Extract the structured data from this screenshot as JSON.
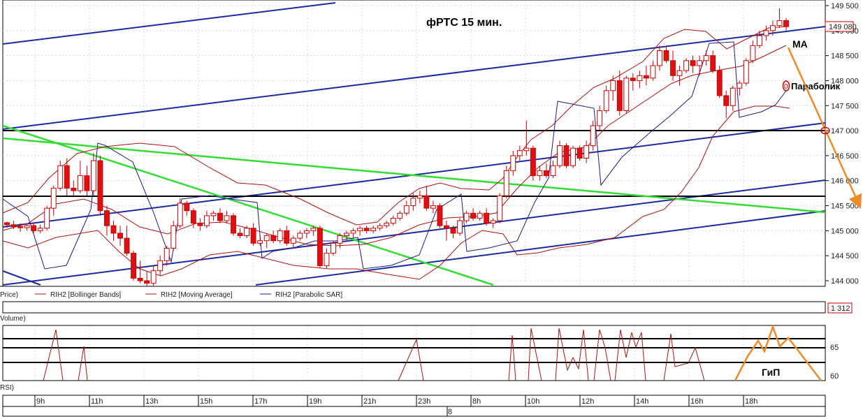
{
  "chart_data": {
    "type": "candlestick",
    "title": "фРТС   15 мин.",
    "ylim": [
      143900,
      149560
    ],
    "y_ticks": [
      "149 500",
      "149 000",
      "148 500",
      "148 000",
      "147 500",
      "147 000",
      "146 500",
      "146 000",
      "145 500",
      "145 000",
      "144 500",
      "144 000"
    ],
    "last_price_label": "149 080",
    "volume_label": "1 312",
    "panel_labels": {
      "price": "Price)",
      "volume": "Volume)",
      "rsi": "RSI)"
    },
    "legend": [
      {
        "name": "RIH2 [Bollinger Bands]",
        "color": "#b21010"
      },
      {
        "name": "RIH2 [Moving Average]",
        "color": "#b21010"
      },
      {
        "name": "RIH2 [Parabolic SAR]",
        "color": "#1c1c8c"
      }
    ],
    "annotations": {
      "ma": "МА",
      "parabolic": "Параболик",
      "rsi_pattern": "ГиП",
      "parabolic_symbol": "0"
    },
    "rsi_ticks": [
      "65",
      "60"
    ],
    "time_labels": [
      "9h",
      "11h",
      "13h",
      "15h",
      "17h",
      "19h",
      "21h",
      "23h",
      "8h",
      "10h",
      "12h",
      "14h",
      "16h",
      "18h"
    ],
    "day_label": "8",
    "candles": [
      [
        145160,
        145180,
        145060,
        145120
      ],
      [
        145120,
        145200,
        145030,
        145080
      ],
      [
        145080,
        145150,
        144980,
        145060
      ],
      [
        145060,
        145120,
        145000,
        145100
      ],
      [
        145100,
        145160,
        144950,
        145000
      ],
      [
        145000,
        145120,
        144950,
        145050
      ],
      [
        145050,
        145500,
        145000,
        145450
      ],
      [
        145450,
        145900,
        145300,
        145850
      ],
      [
        145850,
        146400,
        145800,
        146300
      ],
      [
        146300,
        146450,
        145700,
        145850
      ],
      [
        145850,
        146000,
        145700,
        145800
      ],
      [
        145800,
        146400,
        145750,
        146100
      ],
      [
        146100,
        146300,
        145700,
        145800
      ],
      [
        145800,
        146550,
        145700,
        146400
      ],
      [
        146400,
        146500,
        145300,
        145400
      ],
      [
        145400,
        145500,
        144900,
        145100
      ],
      [
        145100,
        145200,
        144800,
        144950
      ],
      [
        144950,
        145100,
        144700,
        144850
      ],
      [
        144850,
        145100,
        144500,
        144550
      ],
      [
        144550,
        144600,
        144000,
        144050
      ],
      [
        144050,
        144400,
        143950,
        144000
      ],
      [
        144000,
        144200,
        143900,
        143950
      ],
      [
        143950,
        144300,
        143900,
        144200
      ],
      [
        144200,
        144500,
        144100,
        144400
      ],
      [
        144400,
        144700,
        144300,
        144650
      ],
      [
        144650,
        145200,
        144600,
        145100
      ],
      [
        145100,
        145650,
        145050,
        145550
      ],
      [
        145550,
        145600,
        145300,
        145400
      ],
      [
        145400,
        145450,
        145050,
        145150
      ],
      [
        145150,
        145250,
        145000,
        145100
      ],
      [
        145100,
        145400,
        145050,
        145300
      ],
      [
        145300,
        145400,
        145200,
        145350
      ],
      [
        145350,
        145450,
        145150,
        145200
      ],
      [
        145200,
        145400,
        145150,
        145300
      ],
      [
        145300,
        145350,
        144900,
        144950
      ],
      [
        144950,
        145050,
        144850,
        144900
      ],
      [
        144900,
        145100,
        144850,
        145050
      ],
      [
        145050,
        145150,
        144700,
        144750
      ],
      [
        144750,
        144900,
        144700,
        144800
      ],
      [
        144800,
        144950,
        144650,
        144900
      ],
      [
        144900,
        145000,
        144750,
        144800
      ],
      [
        144800,
        145050,
        144750,
        145000
      ],
      [
        145000,
        145100,
        144700,
        144750
      ],
      [
        144750,
        144900,
        144650,
        144850
      ],
      [
        144850,
        145000,
        144800,
        144950
      ],
      [
        144950,
        145050,
        144850,
        145000
      ],
      [
        145000,
        145100,
        144900,
        145050
      ],
      [
        145050,
        145100,
        144250,
        144300
      ],
      [
        144300,
        144650,
        144250,
        144550
      ],
      [
        144550,
        144800,
        144500,
        144750
      ],
      [
        144750,
        144950,
        144650,
        144900
      ],
      [
        144900,
        145000,
        144800,
        144950
      ],
      [
        144950,
        145050,
        144850,
        145000
      ],
      [
        145000,
        145100,
        144900,
        145050
      ],
      [
        145050,
        145100,
        144950,
        145000
      ],
      [
        145000,
        145100,
        144950,
        145050
      ],
      [
        145050,
        145150,
        145000,
        145100
      ],
      [
        145100,
        145200,
        145050,
        145150
      ],
      [
        145150,
        145300,
        145100,
        145250
      ],
      [
        145250,
        145400,
        145200,
        145350
      ],
      [
        145350,
        145600,
        145300,
        145500
      ],
      [
        145500,
        145750,
        145400,
        145650
      ],
      [
        145650,
        145800,
        145550,
        145700
      ],
      [
        145700,
        145900,
        145400,
        145450
      ],
      [
        145450,
        145600,
        145350,
        145500
      ],
      [
        145500,
        145550,
        145050,
        145100
      ],
      [
        145100,
        145200,
        144800,
        145050
      ],
      [
        145050,
        145100,
        144850,
        144950
      ],
      [
        144950,
        145250,
        144900,
        145200
      ],
      [
        145200,
        145400,
        145150,
        145350
      ],
      [
        145350,
        145450,
        145200,
        145250
      ],
      [
        145250,
        145400,
        145200,
        145350
      ],
      [
        145350,
        145450,
        145100,
        145150
      ],
      [
        145150,
        145250,
        145050,
        145200
      ],
      [
        145200,
        145750,
        145150,
        145700
      ],
      [
        145700,
        146300,
        145650,
        146200
      ],
      [
        146200,
        146600,
        146100,
        146500
      ],
      [
        146500,
        146700,
        146400,
        146600
      ],
      [
        146600,
        147200,
        146500,
        146650
      ],
      [
        146650,
        146700,
        146000,
        146100
      ],
      [
        146100,
        146300,
        146000,
        146200
      ],
      [
        146200,
        146350,
        146050,
        146100
      ],
      [
        146100,
        146400,
        146050,
        146300
      ],
      [
        146300,
        146800,
        146250,
        146700
      ],
      [
        146700,
        146750,
        146250,
        146300
      ],
      [
        146300,
        146700,
        146250,
        146650
      ],
      [
        146650,
        146700,
        146400,
        146450
      ],
      [
        146450,
        146800,
        146350,
        146700
      ],
      [
        146700,
        147200,
        146600,
        147100
      ],
      [
        147100,
        147500,
        147000,
        147400
      ],
      [
        147400,
        147900,
        147350,
        147800
      ],
      [
        147800,
        148100,
        147600,
        148000
      ],
      [
        148000,
        148200,
        147300,
        147400
      ],
      [
        147400,
        148100,
        147350,
        148050
      ],
      [
        148050,
        148150,
        147800,
        148000
      ],
      [
        148000,
        148200,
        147850,
        148100
      ],
      [
        148100,
        148300,
        147900,
        148050
      ],
      [
        148050,
        148400,
        148000,
        148300
      ],
      [
        148300,
        148700,
        148200,
        148600
      ],
      [
        148600,
        148700,
        148350,
        148400
      ],
      [
        148400,
        148600,
        148000,
        148100
      ],
      [
        148100,
        148300,
        147900,
        148200
      ],
      [
        148200,
        148450,
        148150,
        148400
      ],
      [
        148400,
        148500,
        148150,
        148300
      ],
      [
        148300,
        148500,
        148100,
        148400
      ],
      [
        148400,
        148600,
        148300,
        148500
      ],
      [
        148500,
        148600,
        148150,
        148200
      ],
      [
        148200,
        148300,
        147650,
        147700
      ],
      [
        147700,
        147800,
        147250,
        147500
      ],
      [
        147500,
        147900,
        147400,
        147850
      ],
      [
        147850,
        148000,
        147700,
        147950
      ],
      [
        147950,
        148450,
        147900,
        148400
      ],
      [
        148400,
        148800,
        148350,
        148700
      ],
      [
        148700,
        149000,
        148650,
        148900
      ],
      [
        148900,
        149100,
        148800,
        149000
      ],
      [
        149000,
        149200,
        148900,
        149100
      ],
      [
        149100,
        149450,
        149050,
        149200
      ],
      [
        149200,
        149250,
        149000,
        149080
      ]
    ]
  }
}
